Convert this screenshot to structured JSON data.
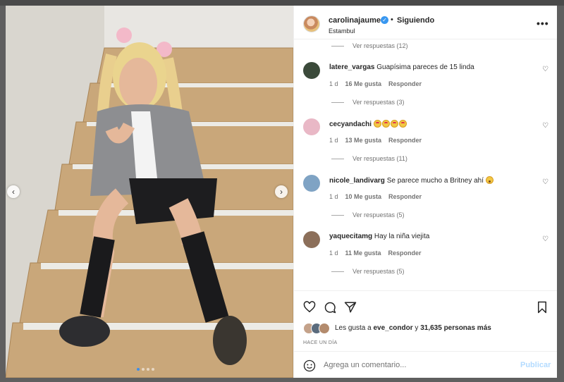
{
  "header": {
    "username": "carolinajaume",
    "separator": "•",
    "follow_label": "Siguiendo",
    "location": "Estambul",
    "more": "•••"
  },
  "top_view_replies": "Ver respuestas (12)",
  "comments": [
    {
      "username": "latere_vargas",
      "text": "Guapísima pareces de 15 linda",
      "time": "1 d",
      "likes": "16 Me gusta",
      "reply": "Responder",
      "view_replies": "Ver respuestas (3)",
      "avatar_color": "#3b4a3a"
    },
    {
      "username": "cecyandachi",
      "text": "",
      "emojis": [
        "love",
        "love",
        "love",
        "love"
      ],
      "time": "1 d",
      "likes": "13 Me gusta",
      "reply": "Responder",
      "view_replies": "Ver respuestas (11)",
      "avatar_color": "#e9b8c6"
    },
    {
      "username": "nicole_landivarg",
      "text": "Se parece mucho a Britney ahí",
      "emojis": [
        "wow"
      ],
      "time": "1 d",
      "likes": "10 Me gusta",
      "reply": "Responder",
      "view_replies": "Ver respuestas (5)",
      "avatar_color": "#7fa3c4"
    },
    {
      "username": "yaquecitamg",
      "text": "Hay la niña viejita",
      "time": "1 d",
      "likes": "11 Me gusta",
      "reply": "Responder",
      "view_replies": "Ver respuestas (5)",
      "avatar_color": "#8c6f5a"
    }
  ],
  "actions": {
    "icons": [
      "heart-icon",
      "comment-icon",
      "share-icon",
      "bookmark-icon"
    ],
    "likes_prefix": "Les gusta a",
    "likes_user": "eve_condor",
    "likes_middle": "y",
    "likes_count": "31,635 personas más",
    "time_ago": "HACE UN DÍA"
  },
  "comment_bar": {
    "placeholder": "Agrega un comentario...",
    "publish_label": "Publicar"
  },
  "carousel": {
    "prev": "‹",
    "next": "›",
    "slides": 4,
    "active_slide": 1
  },
  "colors": {
    "accent": "#3897f0",
    "publish_disabled": "#b3dbff",
    "muted_text": "#737373"
  }
}
